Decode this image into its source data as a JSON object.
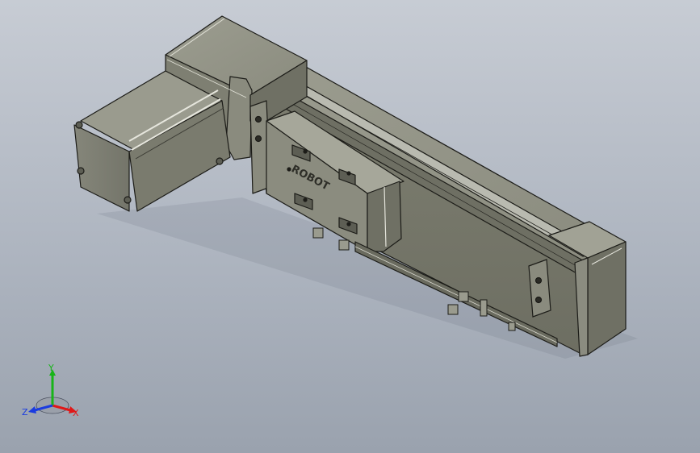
{
  "viewport": {
    "background_top": "#c7ccd4",
    "background_bottom": "#9aa2ae"
  },
  "model": {
    "body_color": "#7c7d6f",
    "edge_color": "#1c1c18",
    "highlight_color": "#d9d9cf",
    "carriage_logo": "ROBOT"
  },
  "triad": {
    "x_label": "X",
    "y_label": "Y",
    "z_label": "Z",
    "x_color": "#e01818",
    "y_color": "#18b418",
    "z_color": "#1a3be0"
  }
}
